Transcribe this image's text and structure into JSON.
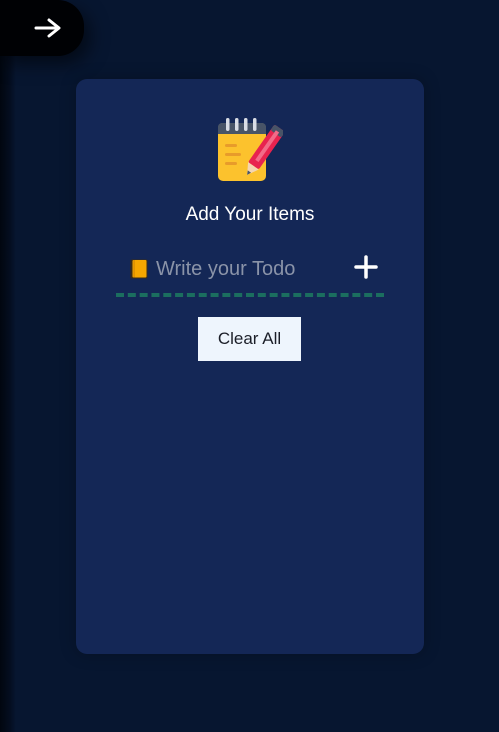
{
  "toggle": {
    "icon": "arrow-right-icon"
  },
  "card": {
    "logo_icon": "notepad-pen-icon",
    "title": "Add Your Items",
    "input": {
      "icon": "book-icon",
      "placeholder": "Write your Todo",
      "value": ""
    },
    "add_icon": "plus-icon",
    "clear_label": "Clear All"
  },
  "colors": {
    "background": "#071630",
    "card": "#142756",
    "underline": "#1b6e5f",
    "clear_button": "#eef5fd",
    "toggle": "#000104"
  }
}
